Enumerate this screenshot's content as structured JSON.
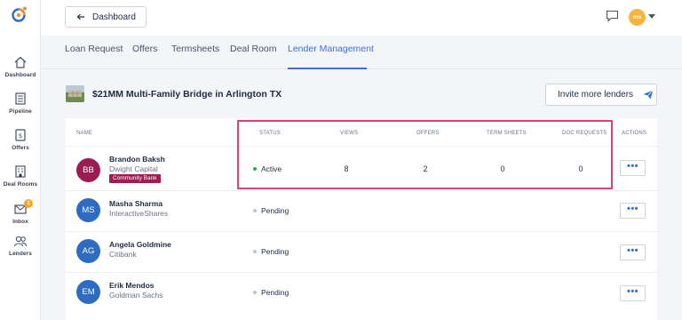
{
  "sidebar": {
    "items": [
      {
        "label": "Dashboard",
        "icon": "home-icon"
      },
      {
        "label": "Pipeline",
        "icon": "pipeline-icon"
      },
      {
        "label": "Offers",
        "icon": "offers-icon"
      },
      {
        "label": "Deal Rooms",
        "icon": "deal-rooms-icon"
      },
      {
        "label": "Inbox",
        "icon": "inbox-icon",
        "badge": "1"
      },
      {
        "label": "Lenders",
        "icon": "lenders-icon"
      }
    ]
  },
  "topbar": {
    "dashboard_label": "Dashboard",
    "user_initials": "ms"
  },
  "tabs": [
    "Loan Request",
    "Offers",
    "Termsheets",
    "Deal Room",
    "Lender Management"
  ],
  "active_tab": "Lender Management",
  "deal": {
    "title": "$21MM Multi-Family Bridge in Arlington TX",
    "invite_label": "Invite more lenders"
  },
  "table": {
    "headers": {
      "name": "NAME",
      "status": "STATUS",
      "views": "VIEWS",
      "offers": "OFFERS",
      "term_sheets": "TERM SHEETS",
      "doc_requests": "DOC REQUESTS",
      "actions": "ACTIONS"
    },
    "rows": [
      {
        "initials": "BB",
        "name": "Brandon Baksh",
        "company": "Dwight Capital",
        "tag": "Community Bank",
        "status": "Active",
        "views": "8",
        "offers": "2",
        "term_sheets": "0",
        "doc_requests": "0",
        "action": "•••"
      },
      {
        "initials": "MS",
        "name": "Masha Sharma",
        "company": "InteractiveShares",
        "status": "Pending",
        "action": "•••"
      },
      {
        "initials": "AG",
        "name": "Angela Goldmine",
        "company": "Citibank",
        "status": "Pending",
        "action": "•••"
      },
      {
        "initials": "EM",
        "name": "Erik Mendos",
        "company": "Goldman Sachs",
        "status": "Pending",
        "action": "•••"
      }
    ]
  },
  "colors": {
    "accent": "#3d6fd8",
    "active_dot": "#2fa84f",
    "pending_dot": "#bfc3cc",
    "avatar_active": "#9b1b52",
    "avatar_default": "#2d6cc0",
    "highlight": "#e0407a",
    "badge": "#f5a623"
  }
}
